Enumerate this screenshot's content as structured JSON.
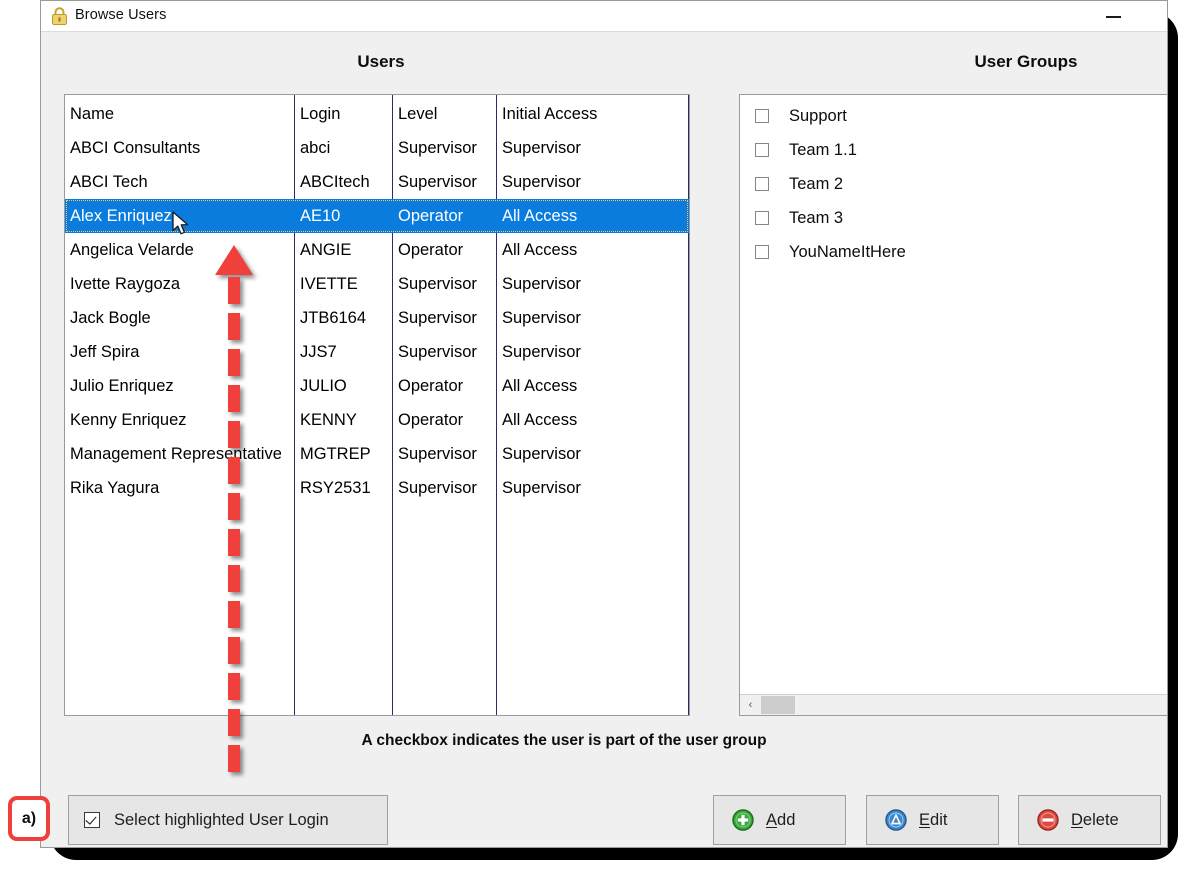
{
  "window": {
    "title": "Browse Users",
    "lock_icon": "lock-icon",
    "minimize_label": "Minimize"
  },
  "panels": {
    "users_title": "Users",
    "groups_title": "User Groups"
  },
  "users_table": {
    "columns": [
      "Name",
      "Login",
      "Level",
      "Initial Access"
    ],
    "selected_index": 2,
    "rows": [
      {
        "name": "ABCI Consultants",
        "login": "abci",
        "level": "Supervisor",
        "access": "Supervisor"
      },
      {
        "name": "ABCI Tech",
        "login": "ABCItech",
        "level": "Supervisor",
        "access": "Supervisor"
      },
      {
        "name": "Alex Enriquez",
        "login": "AE10",
        "level": "Operator",
        "access": "All Access"
      },
      {
        "name": "Angelica Velarde",
        "login": "ANGIE",
        "level": "Operator",
        "access": "All Access"
      },
      {
        "name": "Ivette Raygoza",
        "login": "IVETTE",
        "level": "Supervisor",
        "access": "Supervisor"
      },
      {
        "name": "Jack Bogle",
        "login": "JTB6164",
        "level": "Supervisor",
        "access": "Supervisor"
      },
      {
        "name": "Jeff Spira",
        "login": "JJS7",
        "level": "Supervisor",
        "access": "Supervisor"
      },
      {
        "name": "Julio Enriquez",
        "login": "JULIO",
        "level": "Operator",
        "access": "All Access"
      },
      {
        "name": "Kenny Enriquez",
        "login": "KENNY",
        "level": "Operator",
        "access": "All Access"
      },
      {
        "name": "Management Representative",
        "login": "MGTREP",
        "level": "Supervisor",
        "access": "Supervisor"
      },
      {
        "name": "Rika Yagura",
        "login": "RSY2531",
        "level": "Supervisor",
        "access": "Supervisor"
      }
    ]
  },
  "user_groups": {
    "items": [
      {
        "label": "Support",
        "checked": false
      },
      {
        "label": "Team 1.1",
        "checked": false
      },
      {
        "label": "Team 2",
        "checked": false
      },
      {
        "label": "Team 3",
        "checked": false
      },
      {
        "label": "YouNameItHere",
        "checked": false
      }
    ],
    "scrollbar": {
      "left_arrow": "‹"
    }
  },
  "hint_text": "A checkbox indicates the user is part of the user group",
  "buttons": {
    "select_login": {
      "label": "Select highlighted User Login",
      "checked": true
    },
    "add": {
      "label": "Add",
      "accel": "A",
      "rest": "dd",
      "icon": "plus-circle-icon",
      "color": "#2f9b2f"
    },
    "edit": {
      "label": "Edit",
      "accel": "E",
      "rest": "dit",
      "icon": "triangle-circle-icon",
      "color": "#2f7fd0"
    },
    "delete": {
      "label": "Delete",
      "accel": "D",
      "rest": "elete",
      "icon": "minus-circle-icon",
      "color": "#d83a33"
    }
  },
  "annotations": {
    "badge_label": "a)",
    "arrow": {
      "color": "#f0403c",
      "direction": "up"
    }
  }
}
